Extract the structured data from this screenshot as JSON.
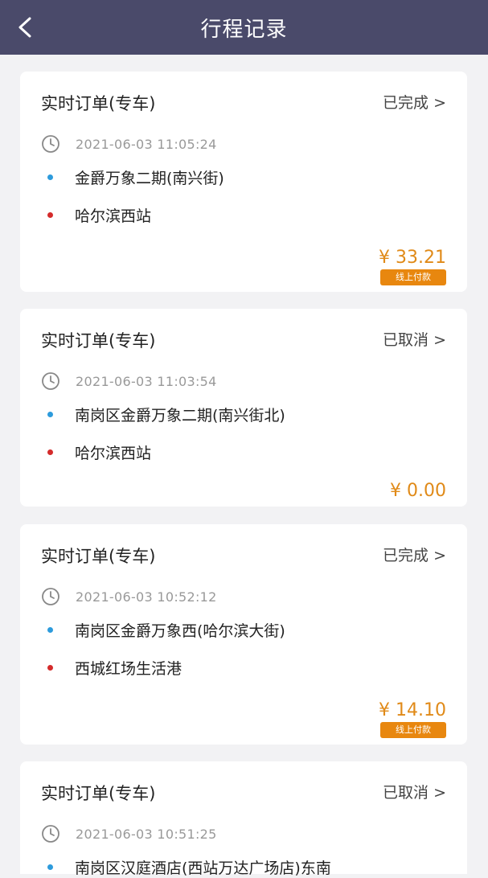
{
  "header": {
    "title": "行程记录",
    "back_icon": "chevron-left-icon"
  },
  "trips": [
    {
      "title": "实时订单(专车)",
      "status": "已完成 >",
      "time": "2021-06-03 11:05:24",
      "start": "金爵万象二期(南兴街)",
      "end": "哈尔滨西站",
      "price": "¥ 33.21",
      "pay_badge": "线上付款"
    },
    {
      "title": "实时订单(专车)",
      "status": "已取消 >",
      "time": "2021-06-03 11:03:54",
      "start": "南岗区金爵万象二期(南兴街北)",
      "end": "哈尔滨西站",
      "price": "¥ 0.00"
    },
    {
      "title": "实时订单(专车)",
      "status": "已完成 >",
      "time": "2021-06-03 10:52:12",
      "start": "南岗区金爵万象西(哈尔滨大街)",
      "end": "西城红场生活港",
      "price": "¥ 14.10",
      "pay_badge": "线上付款"
    },
    {
      "title": "实时订单(专车)",
      "status": "已取消 >",
      "time": "2021-06-03 10:51:25",
      "start": "南岗区汉庭酒店(西站万达广场店)东南"
    }
  ],
  "colors": {
    "header_bg": "#4a4a6a",
    "start_dot": "#2d9bdc",
    "end_dot": "#d42b2b",
    "price": "#e08a18",
    "badge": "#e8870f"
  }
}
